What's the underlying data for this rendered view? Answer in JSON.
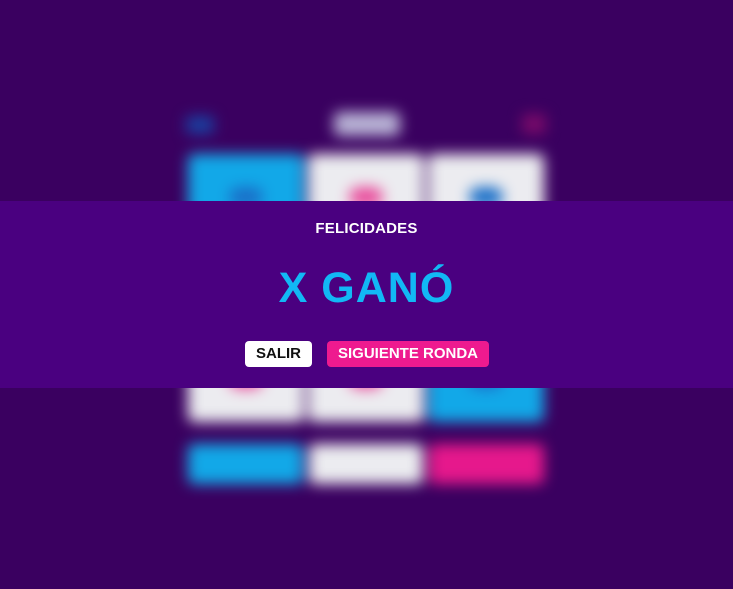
{
  "modal": {
    "subtitle": "FELICIDADES",
    "title": "X GANÓ",
    "quit_label": "SALIR",
    "next_label": "SIGUIENTE RONDA"
  },
  "board": {
    "cells": [
      "x",
      "o",
      "x",
      "",
      "",
      "",
      "o",
      "o",
      "x"
    ],
    "winning_cells": [
      0,
      8
    ]
  },
  "colors": {
    "background": "#3a0060",
    "modal_band": "#4a0080",
    "x_color": "#12b8f5",
    "o_color": "#ee1a8f",
    "neutral": "#ececf0"
  }
}
